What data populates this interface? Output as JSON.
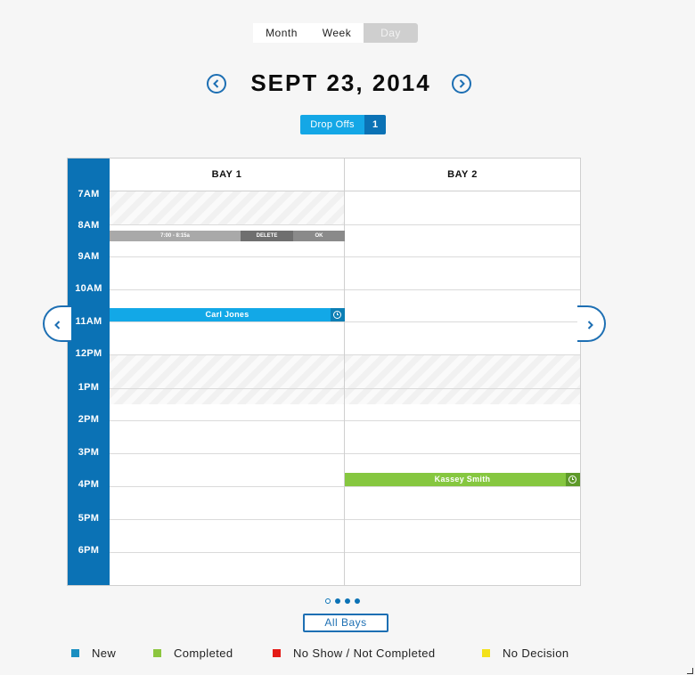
{
  "view_toggle": {
    "month": "Month",
    "week": "Week",
    "day": "Day",
    "selected": "Day"
  },
  "header": {
    "date": "SEPT 23, 2014"
  },
  "dropoffs": {
    "label": "Drop Offs",
    "count": "1"
  },
  "bays": [
    "BAY 1",
    "BAY 2"
  ],
  "times": [
    "7AM",
    "8AM",
    "9AM",
    "10AM",
    "11AM",
    "12PM",
    "1PM",
    "2PM",
    "3PM",
    "4PM",
    "5PM",
    "6PM"
  ],
  "pending_slot": {
    "time": "7:00 - 8:15a",
    "delete": "DELETE",
    "ok": "OK"
  },
  "appointments": [
    {
      "name": "Carl Jones",
      "bay": "BAY 1",
      "status": "New",
      "color": "#12a8e7"
    },
    {
      "name": "Kassey Smith",
      "bay": "BAY 2",
      "status": "Completed",
      "color": "#86c740"
    }
  ],
  "pager": {
    "pages": 4,
    "current": 1
  },
  "all_bays_label": "All Bays",
  "legend": [
    {
      "label": "New",
      "color": "#1a8fc1"
    },
    {
      "label": "Completed",
      "color": "#8cc63f"
    },
    {
      "label": "No Show / Not Completed",
      "color": "#e41b17"
    },
    {
      "label": "No Decision",
      "color": "#f3e11a"
    }
  ],
  "colors": {
    "primary": "#0b72b5",
    "accent": "#14a7e6",
    "border": "#cfcfcf"
  }
}
